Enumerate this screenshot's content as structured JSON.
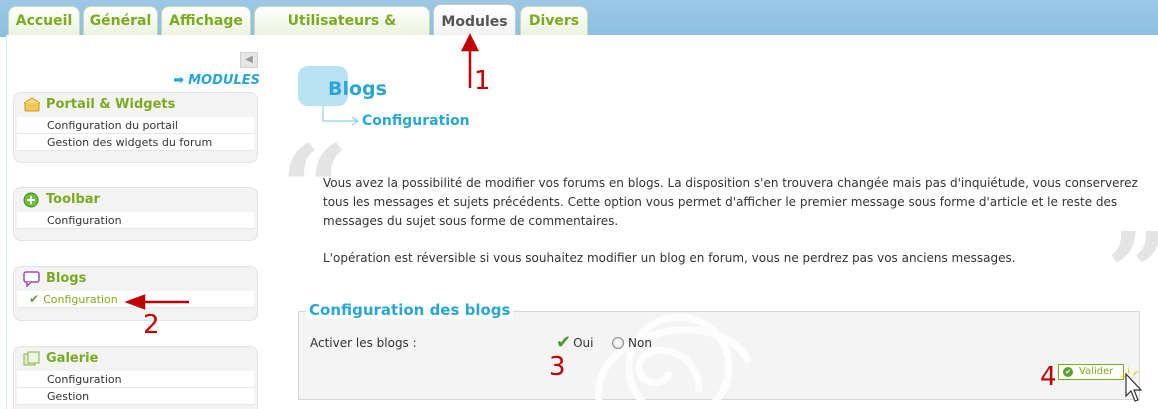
{
  "tabs": [
    {
      "label": "Accueil"
    },
    {
      "label": "Général"
    },
    {
      "label": "Affichage"
    },
    {
      "label": "Utilisateurs & Groupes"
    },
    {
      "label": "Modules",
      "active": true
    },
    {
      "label": "Divers"
    }
  ],
  "sidebar": {
    "collapse_glyph": "◀",
    "section_title": "MODULES",
    "boxes": [
      {
        "title": "Portail & Widgets",
        "icon": "portal-icon",
        "items": [
          "Configuration du portail",
          "Gestion des widgets du forum"
        ]
      },
      {
        "title": "Toolbar",
        "icon": "plus-circle-icon",
        "items": [
          "Configuration"
        ]
      },
      {
        "title": "Blogs",
        "icon": "speech-bubble-icon",
        "items": [
          "Configuration"
        ]
      },
      {
        "title": "Galerie",
        "icon": "gallery-icon",
        "items": [
          "Configuration",
          "Gestion"
        ]
      }
    ]
  },
  "main": {
    "title": "Blogs",
    "subtitle": "Configuration",
    "paragraph1": "Vous avez la possibilité de modifier vos forums en blogs. La disposition s'en trouvera changée mais pas d'inquiétude, vous conserverez tous les messages et sujets précédents. Cette option vous permet d'afficher le premier message sous forme d'article et le reste des messages du sujet sous forme de commentaires.",
    "paragraph2": "L'opération est réversible si vous souhaitez modifier un blog en forum, vous ne perdrez pas vos anciens messages.",
    "fieldset_title": "Configuration des blogs",
    "field_label": "Activer les blogs :",
    "option_yes": "Oui",
    "option_no": "Non",
    "selected": "Oui",
    "submit": "Valider"
  },
  "annotations": [
    "1",
    "2",
    "3",
    "4"
  ],
  "colors": {
    "accent_green": "#7aab1e",
    "accent_blue": "#2aa6d6",
    "annotation_red": "#c00000",
    "topbar_blue": "#9cc8e6"
  }
}
